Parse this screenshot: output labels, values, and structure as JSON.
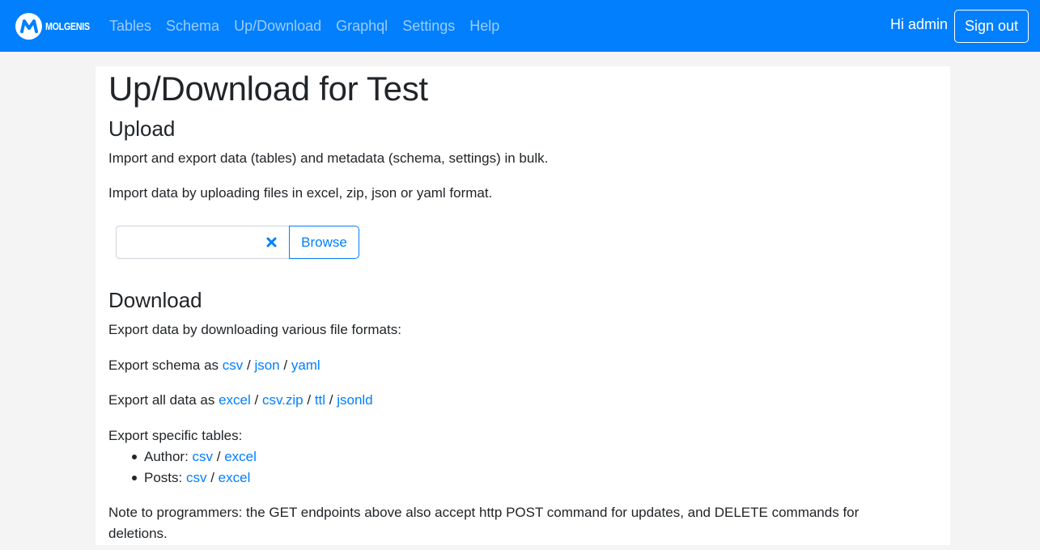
{
  "header": {
    "brand_name": "MOLGENIS",
    "nav": [
      "Tables",
      "Schema",
      "Up/Download",
      "Graphql",
      "Settings",
      "Help"
    ],
    "greeting": "Hi admin",
    "sign_out_label": "Sign out"
  },
  "main": {
    "title": "Up/Download for Test",
    "upload": {
      "heading": "Upload",
      "intro": "Import and export data (tables) and metadata (schema, settings) in bulk.",
      "instructions": "Import data by uploading files in excel, zip, json or yaml format.",
      "browse_label": "Browse"
    },
    "download": {
      "heading": "Download",
      "intro": "Export data by downloading various file formats:",
      "schema_prefix": "Export schema as ",
      "schema_formats": [
        "csv",
        "json",
        "yaml"
      ],
      "all_prefix": "Export all data as ",
      "all_formats": [
        "excel",
        "csv.zip",
        "ttl",
        "jsonld"
      ],
      "specific_label": "Export specific tables:",
      "tables": [
        {
          "name": "Author:",
          "formats": [
            "csv",
            "excel"
          ]
        },
        {
          "name": "Posts:",
          "formats": [
            "csv",
            "excel"
          ]
        }
      ],
      "separator": " / ",
      "note_line1": "Note to programmers: the GET endpoints above also accept http POST command for updates, and DELETE commands for",
      "note_line2": "deletions."
    }
  },
  "colors": {
    "primary": "#017ffd",
    "text": "#212529",
    "background": "#f4f4f4"
  }
}
